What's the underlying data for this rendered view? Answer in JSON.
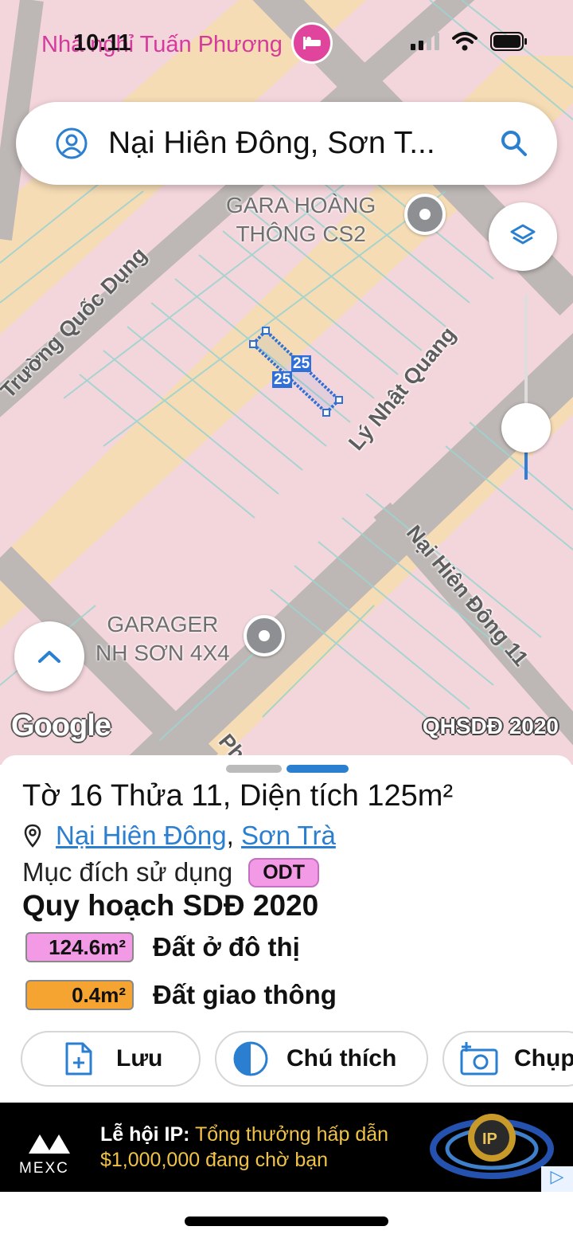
{
  "status_bar": {
    "time": "10:11",
    "top_place_label": "Nhà nghỉ Tuấn Phương"
  },
  "search": {
    "query": "Nại Hiên Đông, Sơn T..."
  },
  "map": {
    "pois": [
      {
        "line1": "GARA HOÀNG",
        "line2": "THÔNG CS2"
      },
      {
        "line1": "GARAGER",
        "line2": "NH SƠN 4X4"
      }
    ],
    "roads": {
      "truong_quoc_dung": "Trường Quốc Dụng",
      "ly_nhat_quang": "Lý Nhật Quang",
      "nai_hien_dong_11": "Nại Hiên Đông 11",
      "pha": "Pha"
    },
    "parcel_numbers": [
      "25",
      "25"
    ],
    "attribution": "Google",
    "layer_tag": "QHSDĐ 2020"
  },
  "parcel": {
    "title": "Tờ 16 Thửa 11, Diện tích 125m²",
    "ward": "Nại Hiên Đông",
    "separator": ",",
    "district": "Sơn Trà",
    "purpose_label": "Mục đích sử dụng",
    "purpose_code": "ODT",
    "plan_title": "Quy hoạch SDĐ 2020",
    "plan_items": [
      {
        "area": "124.6m²",
        "label": "Đất ở đô thị",
        "color": "#f29ae5"
      },
      {
        "area": "0.4m²",
        "label": "Đất giao thông",
        "color": "#f5a431"
      }
    ]
  },
  "actions": {
    "save": "Lưu",
    "legend": "Chú thích",
    "capture": "Chụp"
  },
  "ad": {
    "brand": "MEXC",
    "line1_prefix": "Lễ hội IP:",
    "line1_highlight": " Tổng thưởng hấp dẫn",
    "line2": "$1,000,000 đang chờ bạn"
  },
  "colors": {
    "accent_blue": "#2a7fd0",
    "poi_pink": "#e0449c"
  }
}
